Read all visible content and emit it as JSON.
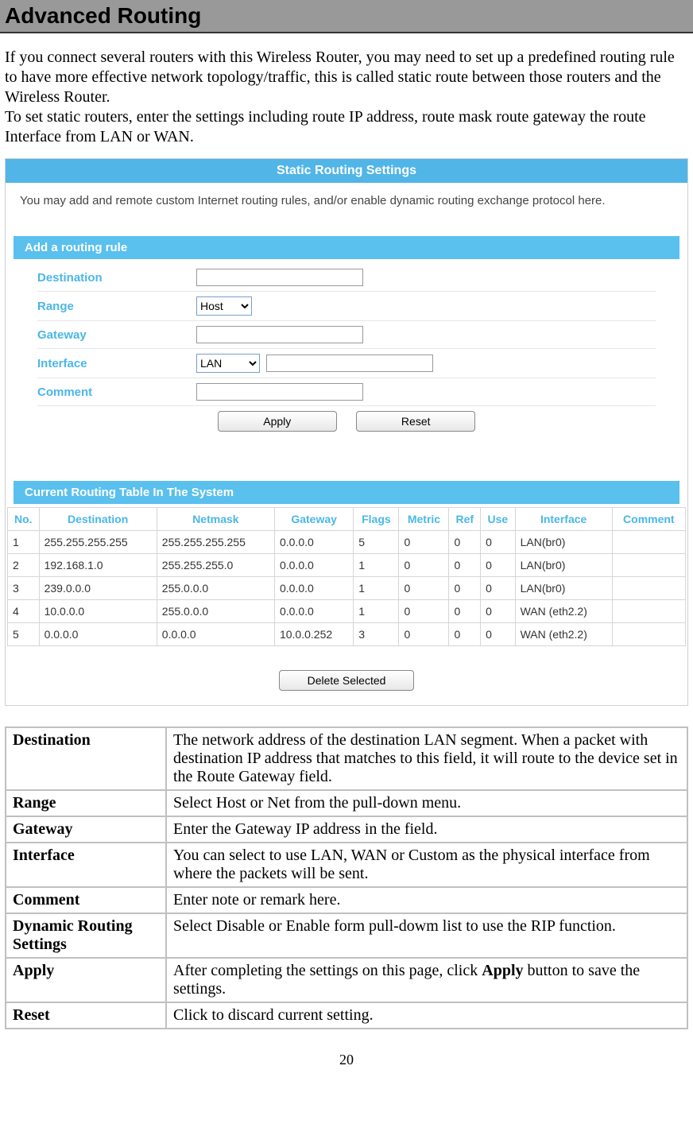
{
  "title": "Advanced Routing",
  "intro1": "If you connect several routers with this Wireless  Router, you may need to set up a predefined routing rule to have more effective network topology/traffic, this is called static route between those routers and the Wireless  Router.",
  "intro2": "To set static routers, enter the settings including route IP address, route mask route gateway the route Interface from LAN or WAN.",
  "sshot": {
    "header": "Static Routing Settings",
    "subtext": "You may add and remote custom Internet routing rules, and/or enable dynamic routing exchange protocol here.",
    "section1": "Add a routing rule",
    "fields": {
      "destination_label": "Destination",
      "range_label": "Range",
      "range_value": "Host",
      "gateway_label": "Gateway",
      "interface_label": "Interface",
      "interface_value": "LAN",
      "comment_label": "Comment"
    },
    "apply_btn": "Apply",
    "reset_btn": "Reset",
    "section2": "Current Routing Table In The System",
    "cols": [
      "No.",
      "Destination",
      "Netmask",
      "Gateway",
      "Flags",
      "Metric",
      "Ref",
      "Use",
      "Interface",
      "Comment"
    ],
    "rows": [
      [
        "1",
        "255.255.255.255",
        "255.255.255.255",
        "0.0.0.0",
        "5",
        "0",
        "0",
        "0",
        "LAN(br0)",
        ""
      ],
      [
        "2",
        "192.168.1.0",
        "255.255.255.0",
        "0.0.0.0",
        "1",
        "0",
        "0",
        "0",
        "LAN(br0)",
        ""
      ],
      [
        "3",
        "239.0.0.0",
        "255.0.0.0",
        "0.0.0.0",
        "1",
        "0",
        "0",
        "0",
        "LAN(br0)",
        ""
      ],
      [
        "4",
        "10.0.0.0",
        "255.0.0.0",
        "0.0.0.0",
        "1",
        "0",
        "0",
        "0",
        "WAN (eth2.2)",
        ""
      ],
      [
        "5",
        "0.0.0.0",
        "0.0.0.0",
        "10.0.0.252",
        "3",
        "0",
        "0",
        "0",
        "WAN (eth2.2)",
        ""
      ]
    ],
    "delete_btn": "Delete Selected"
  },
  "desc": [
    [
      "Destination",
      "The network address of the destination LAN segment. When a packet with destination IP address that matches to this field, it will route to the device set in the Route Gateway field."
    ],
    [
      "Range",
      "Select Host or Net from the pull-down menu."
    ],
    [
      "Gateway",
      "Enter the Gateway IP address in the field."
    ],
    [
      "Interface",
      "You can select to use LAN, WAN or Custom as the physical interface from where the packets will be sent."
    ],
    [
      "Comment",
      "Enter note or remark here."
    ],
    [
      "Dynamic Routing Settings",
      "Select Disable or Enable form pull-dowm list to use the RIP function."
    ],
    [
      "Apply",
      "After completing the settings on this page, click Apply button to save the settings."
    ],
    [
      "Reset",
      "Click to discard current setting."
    ]
  ],
  "apply_word": "Apply",
  "page_number": "20"
}
